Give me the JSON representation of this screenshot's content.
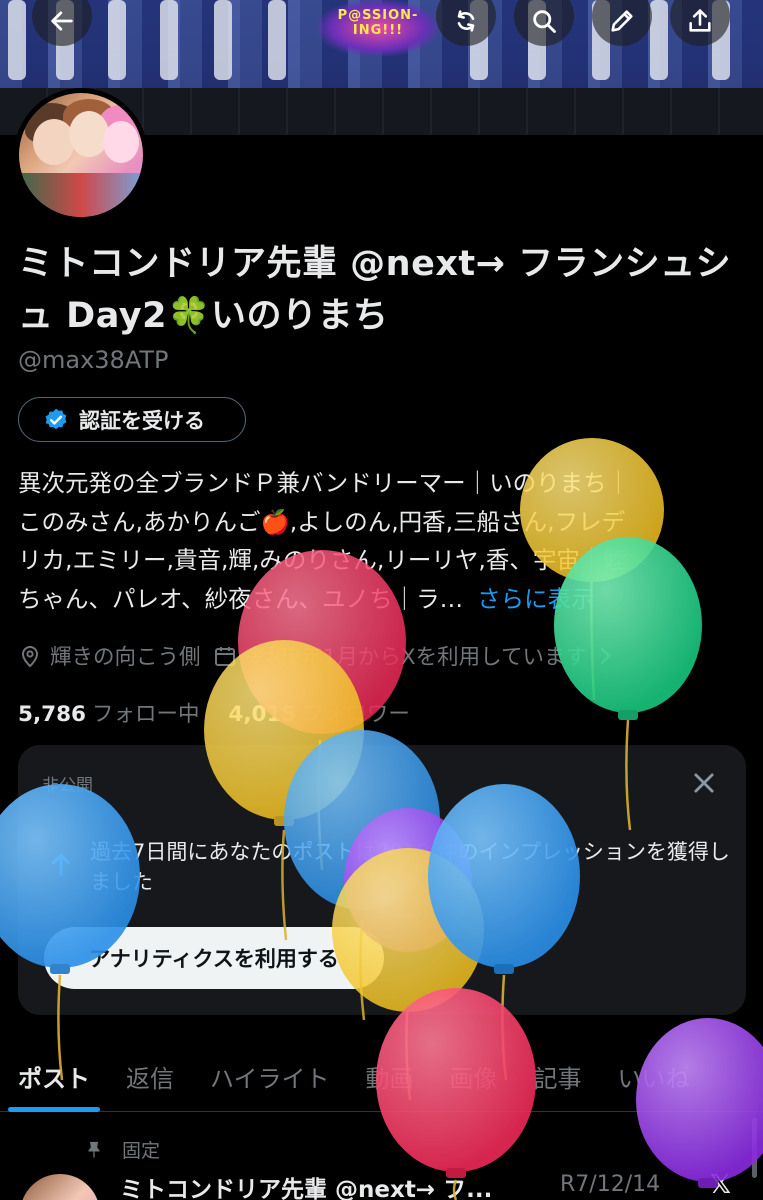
{
  "header": {
    "banner_logo_text": "P@SSION-ING!!!",
    "buttons": [
      "back-arrow-icon",
      "sync-icon",
      "search-icon",
      "edit-icon",
      "share-icon"
    ]
  },
  "profile": {
    "display_name_part1": "ミトコンドリア先輩 @next→ フランシュシュ Day2",
    "display_name_emoji": "🍀",
    "display_name_part2": "いのりまち",
    "handle": "@max38ATP",
    "verify_label": "認証を受ける",
    "bio_line1": "異次元発の全ブランドＰ兼バンドリーマー｜いのりまち｜",
    "bio_line2": "このみさん,あかりんご🍎,よしのん,円香,三船さん,フレデ",
    "bio_line3": "リカ,エミリー,貴音,輝,みのりさん,リーリヤ,香、宇宙｜睦",
    "bio_line4": "ちゃん、パレオ、紗夜さん、ユノち｜ラ…",
    "bio_more": "さらに表示",
    "location": "輝きの向こう側",
    "joined": "令和2年1月からXを利用しています",
    "following_count": "5,786",
    "following_label": "フォロー中",
    "followers_count": "4,015",
    "followers_label": "フォロワー"
  },
  "private_card": {
    "label": "非公開",
    "message": "過去7日間にあなたのポストは7019 件のインプレッションを獲得しました",
    "button": "アナリティクスを利用する"
  },
  "tabs": [
    {
      "label": "ポスト",
      "active": true
    },
    {
      "label": "返信",
      "active": false
    },
    {
      "label": "ハイライト",
      "active": false
    },
    {
      "label": "動画",
      "active": false
    },
    {
      "label": "画像",
      "active": false
    },
    {
      "label": "記事",
      "active": false
    },
    {
      "label": "いいね",
      "active": false
    }
  ],
  "pinned_post": {
    "pinned_label": "固定",
    "author": "ミトコンドリア先輩 @next→ フ...",
    "date": "R7/12/14",
    "source_icon": "x-logo-icon"
  },
  "colors": {
    "accent": "#1d9bf0",
    "background": "#000000",
    "card": "#16181c",
    "muted": "#71767b",
    "text": "#e7e9ea"
  }
}
